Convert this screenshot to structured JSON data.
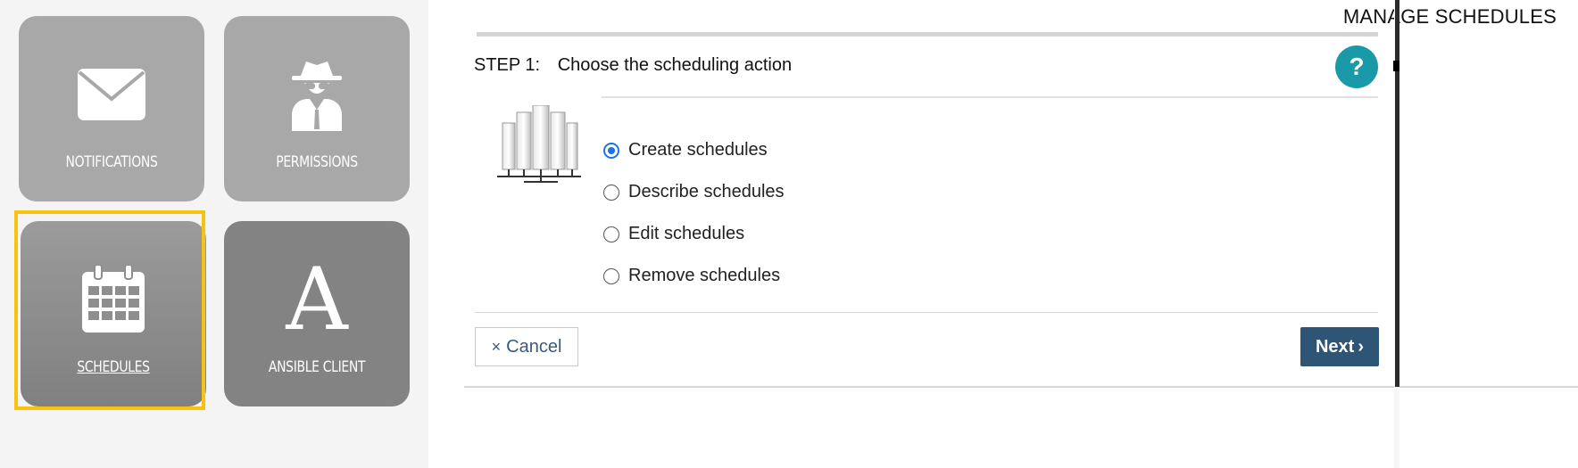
{
  "page_title": "MANAGE SCHEDULES",
  "tiles": {
    "notifications": {
      "label": "NOTIFICATIONS",
      "icon": "envelope-icon"
    },
    "permissions": {
      "label": "PERMISSIONS",
      "icon": "spy-icon"
    },
    "schedules": {
      "label": "SCHEDULES",
      "icon": "calendar-icon",
      "selected": true
    },
    "ansible_client": {
      "label": "ANSIBLE CLIENT",
      "icon": "letter-a-icon",
      "glyph": "A"
    }
  },
  "step": {
    "number": "STEP 1:",
    "title": "Choose the scheduling action",
    "help_label": "?"
  },
  "options": [
    {
      "label": "Create schedules",
      "checked": true
    },
    {
      "label": "Describe schedules",
      "checked": false
    },
    {
      "label": "Edit schedules",
      "checked": false
    },
    {
      "label": "Remove schedules",
      "checked": false
    }
  ],
  "buttons": {
    "cancel_icon": "×",
    "cancel_label": "Cancel",
    "next_label": "Next",
    "next_icon": "›"
  },
  "colors": {
    "highlight": "#f8c20f",
    "help": "#1a9aa8",
    "next": "#2e5575",
    "radio_checked": "#1a73e8"
  }
}
